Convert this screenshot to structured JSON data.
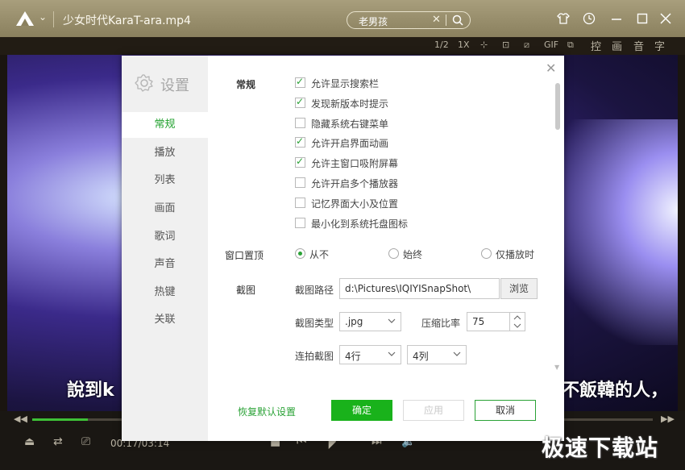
{
  "titlebar": {
    "file_title": "少女时代KaraT-ara.mp4",
    "search_value": "老男孩",
    "icons": [
      "logo-icon",
      "chevron-down-icon",
      "search-icon",
      "skin-icon",
      "clock-icon",
      "minimize-icon",
      "maximize-icon",
      "close-icon"
    ]
  },
  "toolbar": {
    "items": [
      "1/2",
      "1X",
      "",
      "",
      "",
      "GIF",
      "",
      "控",
      "画",
      "音",
      "字"
    ]
  },
  "video": {
    "subtitle_left": "說到k",
    "subtitle_right": "不飯韓的人，"
  },
  "controls": {
    "time": "00:17/03:14",
    "progress": 0.09
  },
  "settings": {
    "title": "设置",
    "nav": [
      "常规",
      "播放",
      "列表",
      "画面",
      "歌词",
      "声音",
      "热键",
      "关联"
    ],
    "active_nav": 0,
    "general": {
      "label": "常规",
      "options": [
        {
          "label": "允许显示搜索栏",
          "checked": true
        },
        {
          "label": "发现新版本时提示",
          "checked": true
        },
        {
          "label": "隐藏系统右键菜单",
          "checked": false
        },
        {
          "label": "允许开启界面动画",
          "checked": true
        },
        {
          "label": "允许主窗口吸附屏幕",
          "checked": true
        },
        {
          "label": "允许开启多个播放器",
          "checked": false
        },
        {
          "label": "记忆界面大小及位置",
          "checked": false
        },
        {
          "label": "最小化到系统托盘图标",
          "checked": false
        }
      ]
    },
    "ontop": {
      "label": "窗口置顶",
      "options": [
        "从不",
        "始终",
        "仅播放时"
      ],
      "selected": 0
    },
    "screenshot": {
      "label": "截图",
      "path_label": "截图路径",
      "path_value": "d:\\Pictures\\IQIYISnapShot\\",
      "browse": "浏览",
      "type_label": "截图类型",
      "type_value": ".jpg",
      "ratio_label": "压缩比率",
      "ratio_value": "75",
      "burst_label": "连拍截图",
      "rows_value": "4行",
      "cols_value": "4列"
    },
    "footer": {
      "restore": "恢复默认设置",
      "ok": "确定",
      "apply": "应用",
      "cancel": "取消"
    }
  },
  "watermark": "极速下载站"
}
